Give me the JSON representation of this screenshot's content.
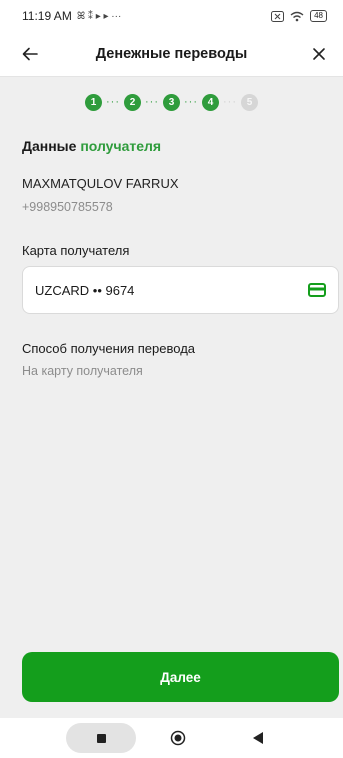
{
  "status_bar": {
    "time": "11:19 AM",
    "notif_icons": "ꕤ ⁑ ▸ ▸ ···",
    "battery": "48"
  },
  "header": {
    "title": "Денежные переводы",
    "back_icon": "arrow-left-icon",
    "close_icon": "close-icon"
  },
  "stepper": {
    "steps": [
      "1",
      "2",
      "3",
      "4",
      "5"
    ],
    "active_count": 4,
    "active_color": "#2f9c3c",
    "inactive_color": "#d6d6d6"
  },
  "recipient": {
    "title_prefix": "Данные",
    "title_accent": "получателя",
    "name": "MAXMATQULOV FARRUX",
    "phone": "+998950785578"
  },
  "card": {
    "label": "Карта получателя",
    "value": "UZCARD •• 9674",
    "icon": "credit-card-icon"
  },
  "method": {
    "label": "Способ получения перевода",
    "value": "На карту получателя"
  },
  "actions": {
    "next_label": "Далее",
    "primary_color": "#149e1c"
  },
  "nav": {
    "recent_icon": "square-icon",
    "home_icon": "circle-icon",
    "back_icon": "triangle-back-icon"
  }
}
